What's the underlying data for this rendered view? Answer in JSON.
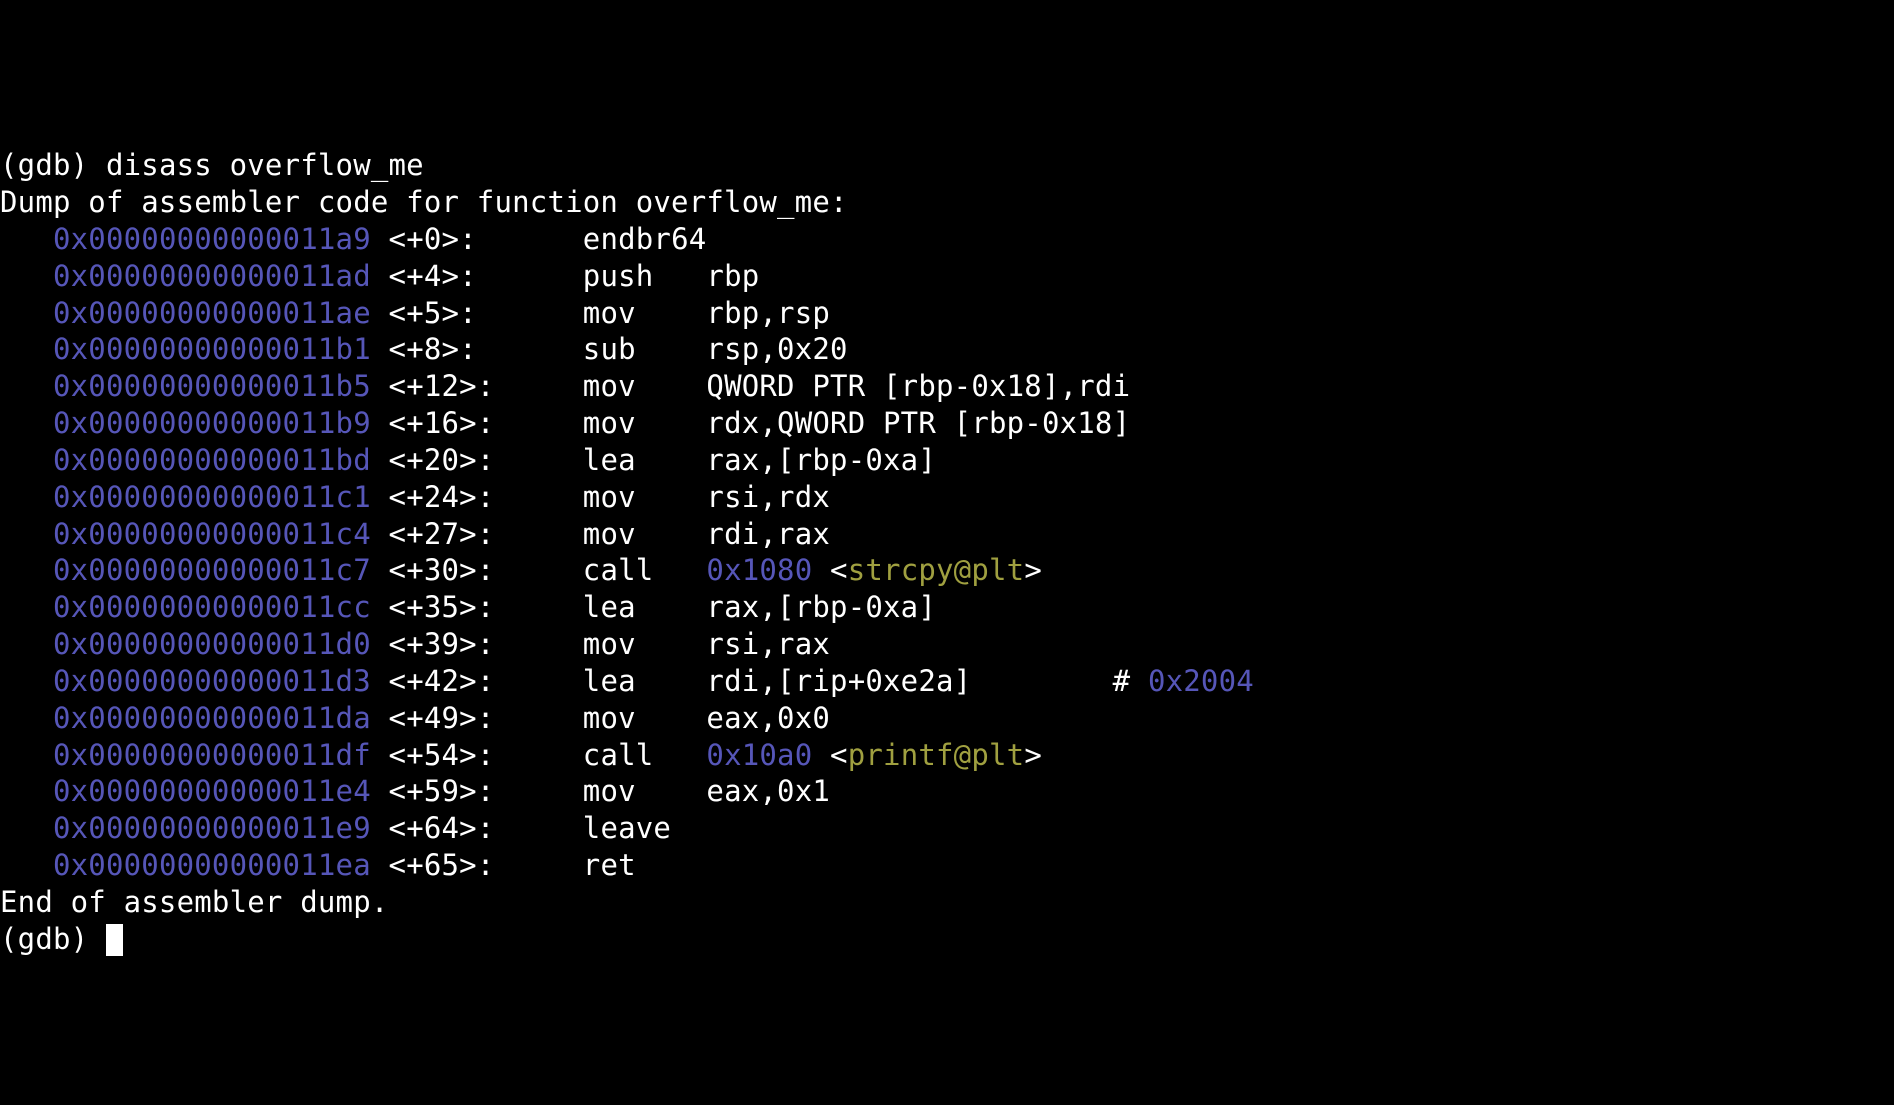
{
  "prompt1": "(gdb) ",
  "command1": "disass overflow_me",
  "dump_header": "Dump of assembler code for function overflow_me:",
  "dump_footer": "End of assembler dump.",
  "prompt2": "(gdb) ",
  "indent": "   ",
  "rows": [
    {
      "addr": "0x00000000000011a9",
      "off": "<+0>:",
      "mnem": "endbr64",
      "args": "",
      "call": "",
      "sym": "",
      "after": "",
      "comment": ""
    },
    {
      "addr": "0x00000000000011ad",
      "off": "<+4>:",
      "mnem": "push",
      "args": "rbp",
      "call": "",
      "sym": "",
      "after": "",
      "comment": ""
    },
    {
      "addr": "0x00000000000011ae",
      "off": "<+5>:",
      "mnem": "mov",
      "args": "rbp,rsp",
      "call": "",
      "sym": "",
      "after": "",
      "comment": ""
    },
    {
      "addr": "0x00000000000011b1",
      "off": "<+8>:",
      "mnem": "sub",
      "args": "rsp,0x20",
      "call": "",
      "sym": "",
      "after": "",
      "comment": ""
    },
    {
      "addr": "0x00000000000011b5",
      "off": "<+12>:",
      "mnem": "mov",
      "args": "QWORD PTR [rbp-0x18],rdi",
      "call": "",
      "sym": "",
      "after": "",
      "comment": ""
    },
    {
      "addr": "0x00000000000011b9",
      "off": "<+16>:",
      "mnem": "mov",
      "args": "rdx,QWORD PTR [rbp-0x18]",
      "call": "",
      "sym": "",
      "after": "",
      "comment": ""
    },
    {
      "addr": "0x00000000000011bd",
      "off": "<+20>:",
      "mnem": "lea",
      "args": "rax,[rbp-0xa]",
      "call": "",
      "sym": "",
      "after": "",
      "comment": ""
    },
    {
      "addr": "0x00000000000011c1",
      "off": "<+24>:",
      "mnem": "mov",
      "args": "rsi,rdx",
      "call": "",
      "sym": "",
      "after": "",
      "comment": ""
    },
    {
      "addr": "0x00000000000011c4",
      "off": "<+27>:",
      "mnem": "mov",
      "args": "rdi,rax",
      "call": "",
      "sym": "",
      "after": "",
      "comment": ""
    },
    {
      "addr": "0x00000000000011c7",
      "off": "<+30>:",
      "mnem": "call",
      "args": "",
      "call": "0x1080",
      "open": " <",
      "sym": "strcpy@plt",
      "after": ">",
      "comment": ""
    },
    {
      "addr": "0x00000000000011cc",
      "off": "<+35>:",
      "mnem": "lea",
      "args": "rax,[rbp-0xa]",
      "call": "",
      "sym": "",
      "after": "",
      "comment": ""
    },
    {
      "addr": "0x00000000000011d0",
      "off": "<+39>:",
      "mnem": "mov",
      "args": "rsi,rax",
      "call": "",
      "sym": "",
      "after": "",
      "comment": ""
    },
    {
      "addr": "0x00000000000011d3",
      "off": "<+42>:",
      "mnem": "lea",
      "args": "rdi,[rip+0xe2a]",
      "call": "",
      "sym": "",
      "after": "",
      "comment_hash": "        # ",
      "comment": "0x2004"
    },
    {
      "addr": "0x00000000000011da",
      "off": "<+49>:",
      "mnem": "mov",
      "args": "eax,0x0",
      "call": "",
      "sym": "",
      "after": "",
      "comment": ""
    },
    {
      "addr": "0x00000000000011df",
      "off": "<+54>:",
      "mnem": "call",
      "args": "",
      "call": "0x10a0",
      "open": " <",
      "sym": "printf@plt",
      "after": ">",
      "comment": ""
    },
    {
      "addr": "0x00000000000011e4",
      "off": "<+59>:",
      "mnem": "mov",
      "args": "eax,0x1",
      "call": "",
      "sym": "",
      "after": "",
      "comment": ""
    },
    {
      "addr": "0x00000000000011e9",
      "off": "<+64>:",
      "mnem": "leave",
      "args": "",
      "call": "",
      "sym": "",
      "after": "",
      "comment": ""
    },
    {
      "addr": "0x00000000000011ea",
      "off": "<+65>:",
      "mnem": "ret",
      "args": "",
      "call": "",
      "sym": "",
      "after": "",
      "comment": ""
    }
  ]
}
